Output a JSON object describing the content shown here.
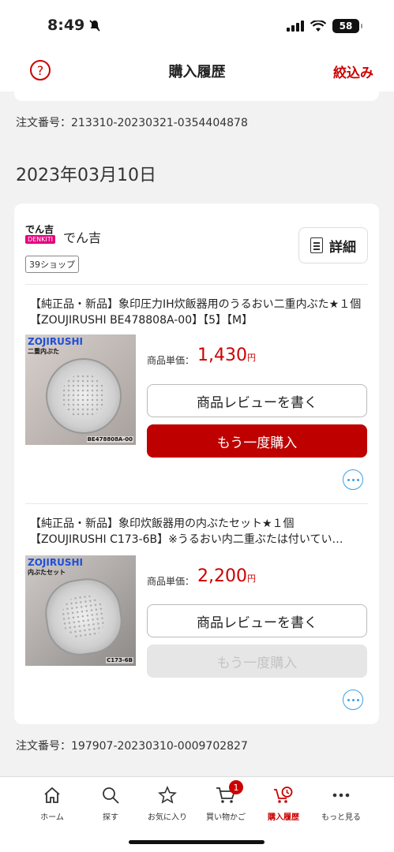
{
  "status": {
    "time": "8:49",
    "battery": "58"
  },
  "header": {
    "title": "購入履歴",
    "filter": "絞込み",
    "help": "?"
  },
  "orders": {
    "prev_order_number": "注文番号：213310-20230321-0354404878",
    "date": "2023年03月10日",
    "shop": {
      "logo_top": "でん吉",
      "logo_bottom": "DENKITI",
      "name": "でん吉",
      "tag": "39ショップ",
      "detail_label": "詳細"
    },
    "items": [
      {
        "title": "【純正品・新品】象印圧力IH炊飯器用のうるおい二重内ぶた★１個【ZOUJIRUSHI BE478808A-00】【5】【M】",
        "img_brand": "ZOJIRUSHI",
        "img_sub": "二重内ぶた",
        "img_code": "BE478808A-00",
        "price_label": "商品単価：",
        "price": "1,430",
        "price_unit": "円",
        "review_label": "商品レビューを書く",
        "rebuy_label": "もう一度購入"
      },
      {
        "title": "【純正品・新品】象印炊飯器用の内ぶたセット★１個【ZOUJIRUSHI C173-6B】※うるおい内二重ぶたは付いてい…",
        "img_brand": "ZOJIRUSHI",
        "img_sub": "内ぶたセット",
        "img_code": "C173-6B",
        "price_label": "商品単価：",
        "price": "2,200",
        "price_unit": "円",
        "review_label": "商品レビューを書く",
        "rebuy_label": "もう一度購入"
      }
    ],
    "order_number": "注文番号：197907-20230310-0009702827"
  },
  "tabs": [
    {
      "label": "ホーム",
      "icon": "home-icon"
    },
    {
      "label": "探す",
      "icon": "search-icon"
    },
    {
      "label": "お気に入り",
      "icon": "star-icon"
    },
    {
      "label": "買い物かご",
      "icon": "cart-icon",
      "badge": "1"
    },
    {
      "label": "購入履歴",
      "icon": "purchase-history-icon",
      "active": true
    },
    {
      "label": "もっと見る",
      "icon": "more-icon"
    }
  ],
  "colors": {
    "accent": "#bf0000",
    "link": "#3aa0e6",
    "background": "#f2f2f2"
  }
}
